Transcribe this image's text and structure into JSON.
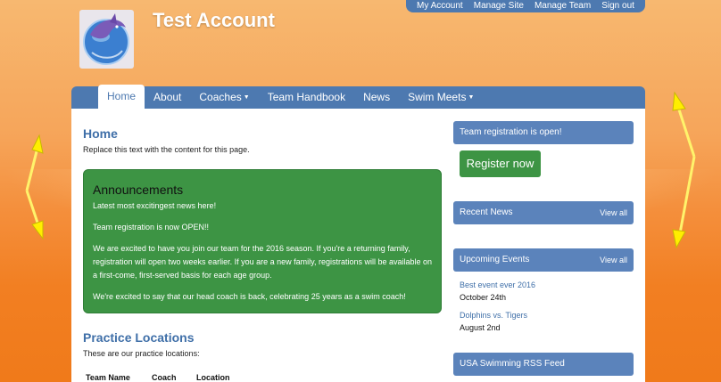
{
  "header": {
    "site_title": "Test Account",
    "top_links": [
      "My Account",
      "Manage Site",
      "Manage Team",
      "Sign out"
    ]
  },
  "nav": {
    "items": [
      {
        "label": "Home",
        "active": true,
        "dropdown": false
      },
      {
        "label": "About",
        "active": false,
        "dropdown": false
      },
      {
        "label": "Coaches",
        "active": false,
        "dropdown": true
      },
      {
        "label": "Team Handbook",
        "active": false,
        "dropdown": false
      },
      {
        "label": "News",
        "active": false,
        "dropdown": false
      },
      {
        "label": "Swim Meets",
        "active": false,
        "dropdown": true
      }
    ]
  },
  "main": {
    "title": "Home",
    "intro": "Replace this text with the content for this page.",
    "announcements": {
      "title": "Announcements",
      "paragraphs": [
        "Latest most excitingest news here!",
        "Team registration is now OPEN!!",
        "We are excited to have you join our team for the 2016 season.  If you're a returning family, registration will open two weeks earlier.  If you are a new family, registrations will be available on a first-come, first-served basis for each age group.",
        "We're excited to say that our head coach is back, celebrating 25 years as a swim coach!"
      ]
    },
    "practice": {
      "title": "Practice Locations",
      "intro": "These are our practice locations:",
      "columns": [
        "Team Name",
        "Coach",
        "Location"
      ]
    }
  },
  "sidebar": {
    "registration": {
      "title": "Team registration is open!",
      "button": "Register now"
    },
    "news": {
      "title": "Recent News",
      "view_all": "View all"
    },
    "events": {
      "title": "Upcoming Events",
      "view_all": "View all",
      "items": [
        {
          "name": "Best event ever 2016",
          "date": "October 24th"
        },
        {
          "name": "Dolphins vs. Tigers",
          "date": "August 2nd"
        }
      ]
    },
    "rss": {
      "title": "USA Swimming RSS Feed"
    }
  },
  "colors": {
    "nav_blue": "#4d79b0",
    "green": "#3d9444",
    "link_blue": "#3f6fa8",
    "arrow_yellow": "#ffee00"
  }
}
